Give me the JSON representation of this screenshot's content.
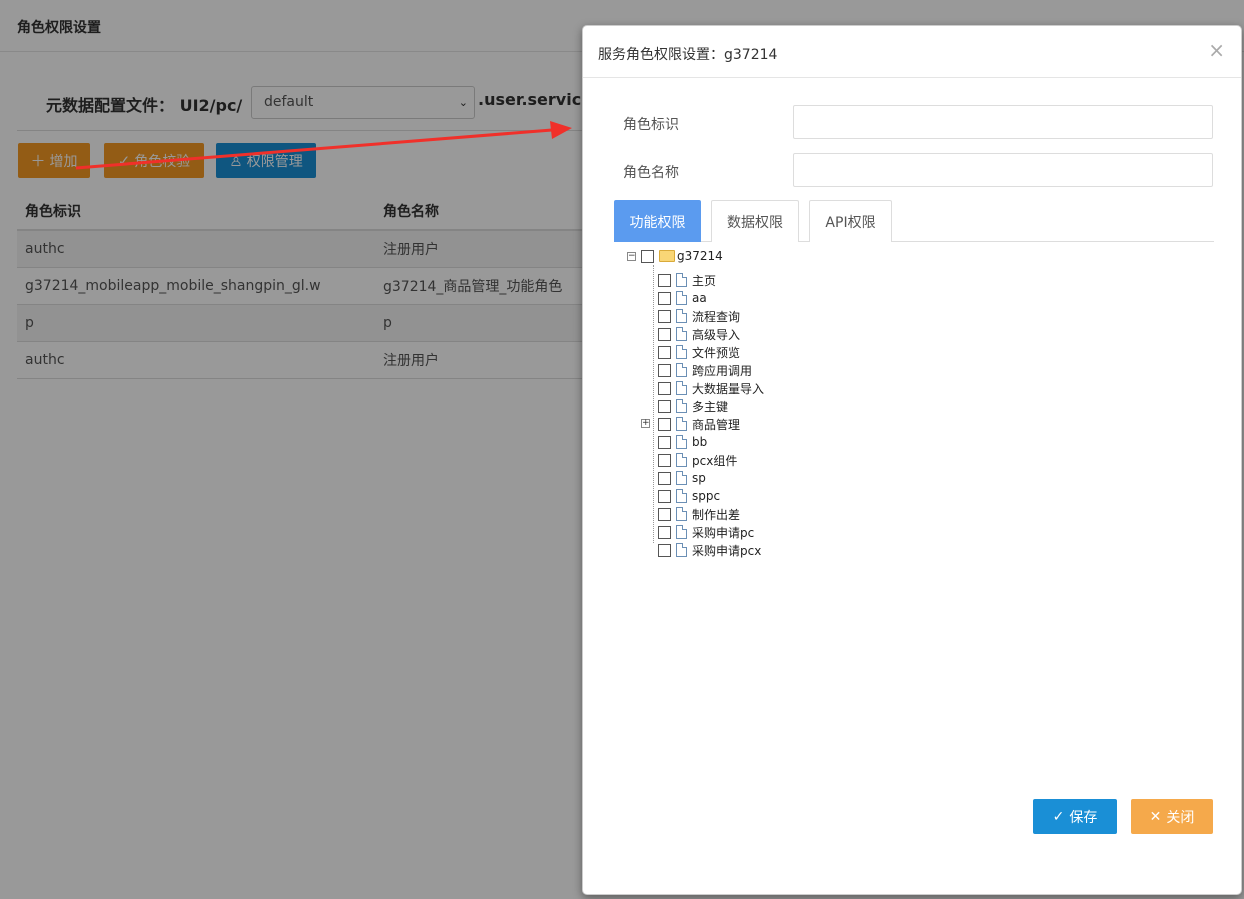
{
  "page": {
    "title": "角色权限设置",
    "meta_label": "元数据配置文件： UI2/pc/",
    "meta_select_value": "default",
    "meta_suffix": ".user.serviceM",
    "buttons": {
      "add": "增加",
      "verify": "角色校验",
      "perm": "权限管理"
    },
    "table": {
      "headers": [
        "角色标识",
        "角色名称"
      ],
      "rows": [
        [
          "authc",
          "注册用户"
        ],
        [
          "g37214_mobileapp_mobile_shangpin_gl.w",
          "g37214_商品管理_功能角色"
        ],
        [
          "p",
          "p"
        ],
        [
          "authc",
          "注册用户"
        ]
      ]
    }
  },
  "modal": {
    "title": "服务角色权限设置：g37214",
    "close_glyph": "×",
    "fields": {
      "role_id_label": "角色标识",
      "role_name_label": "角色名称",
      "role_id_value": "",
      "role_name_value": ""
    },
    "tabs": [
      "功能权限",
      "数据权限",
      "API权限"
    ],
    "tree": {
      "root": "g37214",
      "items": [
        "主页",
        "aa",
        "流程查询",
        "高级导入",
        "文件预览",
        "跨应用调用",
        "大数据量导入",
        "多主键",
        "商品管理",
        "bb",
        "pcx组件",
        "sp",
        "sppc",
        "制作出差",
        "采购申请pc",
        "采购申请pcx"
      ]
    },
    "buttons": {
      "save": "保存",
      "close": "关闭"
    }
  },
  "colors": {
    "orange": "#f59a23",
    "blue": "#1a8fd6",
    "tab_active": "#5b9bef",
    "close_btn": "#f5a94b",
    "arrow": "#f0302a"
  }
}
